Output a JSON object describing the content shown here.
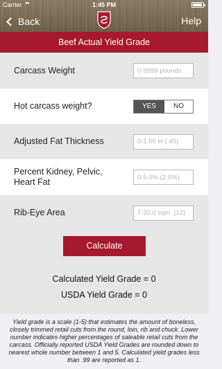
{
  "status": {
    "carrier": "Carrier",
    "time": "1:45 PM"
  },
  "nav": {
    "back_label": "Back",
    "help_label": "Help"
  },
  "title": "Beef Actual Yield Grade",
  "fields": {
    "carcass_weight": {
      "label": "Carcass Weight",
      "placeholder": "0-9999 pounds",
      "value": ""
    },
    "hot_carcass": {
      "label": "Hot carcass weight?",
      "yes": "YES",
      "no": "NO",
      "selected": "YES"
    },
    "fat_thickness": {
      "label": "Adjusted Fat Thickness",
      "placeholder": "0-1.50 in (.45)",
      "value": ""
    },
    "kph": {
      "label_line1": "Percent Kidney, Pelvic,",
      "label_line2": "Heart Fat",
      "placeholder": "0-5.0% (2.5%)",
      "value": ""
    },
    "ribeye": {
      "label": "Rib-Eye Area",
      "placeholder": "7-20.0 sqin. (12)",
      "value": ""
    }
  },
  "calculate_label": "Calculate",
  "results": {
    "calculated": "Calculated Yield Grade = 0",
    "usda": "USDA Yield Grade = 0"
  },
  "footnote": "Yield grade is a scale (1-5) that estimates the amount of boneless, closely trimmed retail cuts from the round, loin, rib and chuck. Lower number indicates higher percentages of saleable retail cuts from the carcass.  Officially reported USDA Yield Grades are rounded down to nearest whole number between 1 and 5. Calculated yield grades less than .99 are reported as 1.",
  "colors": {
    "brand": "#a6192e",
    "header": "#7a6b54",
    "row_gray": "#e6e6e6"
  }
}
